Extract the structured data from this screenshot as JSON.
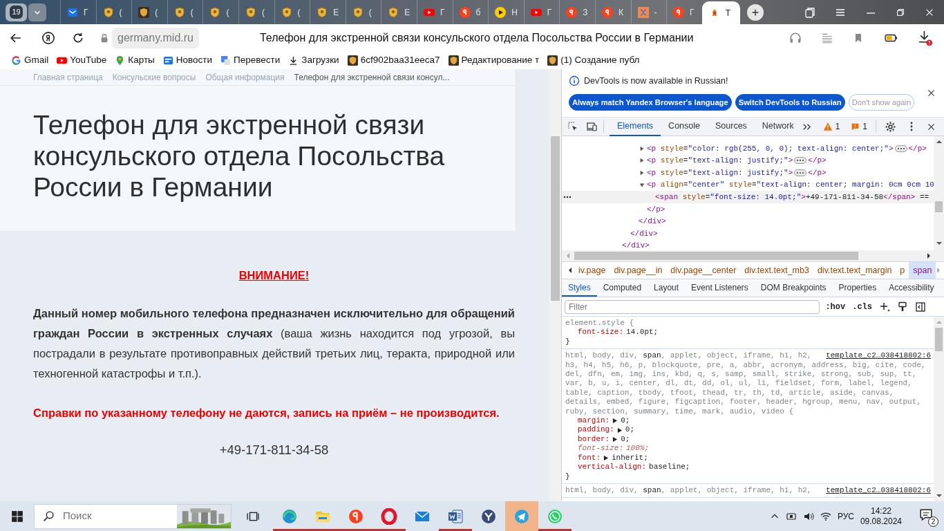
{
  "tab_strip": {
    "tab_count": "19",
    "tabs": [
      {
        "kind": "mail",
        "label": "Г",
        "selected": false
      },
      {
        "kind": "shield",
        "label": "(",
        "selected": false
      },
      {
        "kind": "shield-dark",
        "label": "(",
        "selected": false
      },
      {
        "kind": "shield",
        "label": "(",
        "selected": false
      },
      {
        "kind": "shield",
        "label": "(",
        "selected": false
      },
      {
        "kind": "shield",
        "label": "(",
        "selected": false
      },
      {
        "kind": "shield",
        "label": "(",
        "selected": false
      },
      {
        "kind": "shield",
        "label": "Е",
        "selected": false
      },
      {
        "kind": "shield",
        "label": "(",
        "selected": false
      },
      {
        "kind": "shield",
        "label": "Е",
        "selected": false
      },
      {
        "kind": "youtube",
        "label": "Г",
        "selected": false
      },
      {
        "kind": "yandex",
        "label": "б",
        "selected": false
      },
      {
        "kind": "play",
        "label": "Н",
        "selected": false
      },
      {
        "kind": "youtube",
        "label": "Г",
        "selected": false
      },
      {
        "kind": "yandex",
        "label": "З",
        "selected": false
      },
      {
        "kind": "yandex",
        "label": "К",
        "selected": false
      },
      {
        "kind": "pattern",
        "label": "-",
        "selected": false
      },
      {
        "kind": "yandex",
        "label": "Г",
        "selected": false
      },
      {
        "kind": "emblem",
        "label": "Т",
        "selected": true
      }
    ]
  },
  "toolbar": {
    "url": "germany.mid.ru",
    "page_title": "Телефон для экстренной связи консульского отдела Посольства России в Германии",
    "download_alert": true
  },
  "bookmarks": [
    {
      "kind": "google",
      "label": "Gmail"
    },
    {
      "kind": "youtube",
      "label": "YouTube"
    },
    {
      "kind": "maps",
      "label": "Карты"
    },
    {
      "kind": "news",
      "label": "Новости"
    },
    {
      "kind": "translate",
      "label": "Перевести"
    },
    {
      "kind": "download",
      "label": "Загрузки"
    },
    {
      "kind": "shield-dark",
      "label": "6cf902baa31eeca7"
    },
    {
      "kind": "shield-dark",
      "label": "Редактирование т"
    },
    {
      "kind": "shield-dark",
      "label": "(1) Создание публ"
    }
  ],
  "page": {
    "breadcrumbs": [
      "Главная страница",
      "Консульские вопросы",
      "Общая информация",
      "Телефон для экстренной связи консул..."
    ],
    "heading": "Телефон для экстренной связи консульского отдела Посольства России в Германии",
    "notice": "ВНИМАНИЕ!",
    "paragraph": "**Данный номер мобильного телефона предназначен исключительно для обращений граждан России в экстренных случаях** (ваша жизнь находится под угрозой, вы пострадали в результате противоправных действий третьих лиц, теракта, природной или техногенной катастрофы и т.п.).",
    "warning": "Справки по указанному телефону не даются, запись на приём – не производится.",
    "phone": "+49-171-811-34-58"
  },
  "devtools": {
    "infobar": {
      "message": "DevTools is now available in Russian!",
      "buttons": [
        {
          "label": "Always match Yandex Browser's language",
          "kind": "primary"
        },
        {
          "label": "Switch DevTools to Russian",
          "kind": "primary"
        },
        {
          "label": "Don't show again",
          "kind": "outline"
        }
      ]
    },
    "panels": [
      {
        "label": "Elements",
        "selected": true
      },
      {
        "label": "Console",
        "selected": false
      },
      {
        "label": "Sources",
        "selected": false
      },
      {
        "label": "Network",
        "selected": false
      }
    ],
    "warnings": "1",
    "issues": "1",
    "dom": {
      "close": "</div>",
      "children": [
        {
          "close": "</div>",
          "children": [
            {
              "close": "</div>",
              "children": [
                {
                  "open": "<p style=\"color: rgb(255, 0, 0); text-align: center;\">",
                  "close": "</p>",
                  "expanded": false
                },
                {
                  "open": "<p style=\"text-align: justify;\">",
                  "close": "</p>",
                  "expanded": false
                },
                {
                  "open": "<p style=\"text-align: justify;\">",
                  "close": "</p>",
                  "expanded": false
                },
                {
                  "open": "<p align=\"center\" style=\"text-align: center; margin: 0cm 0cm 10",
                  "close": "</p>",
                  "expanded": true,
                  "children": [
                    {
                      "open": "<span style=\"font-size: 14.0pt;\">+49-171-811-34-58</span> ==",
                      "selected": true
                    }
                  ]
                }
              ]
            }
          ]
        }
      ]
    },
    "crumbs": [
      {
        "label": "iv.page",
        "selected": false
      },
      {
        "label": "div.page__in",
        "selected": false
      },
      {
        "label": "div.page__center",
        "selected": false
      },
      {
        "label": "div.text.text_mb3",
        "selected": false
      },
      {
        "label": "div.text.text_margin",
        "selected": false
      },
      {
        "label": "p",
        "selected": false
      },
      {
        "label": "span",
        "selected": true
      }
    ],
    "style_tabs": [
      {
        "label": "Styles",
        "selected": true
      },
      {
        "label": "Computed",
        "selected": false
      },
      {
        "label": "Layout",
        "selected": false
      },
      {
        "label": "Event Listeners",
        "selected": false
      },
      {
        "label": "DOM Breakpoints",
        "selected": false
      },
      {
        "label": "Properties",
        "selected": false
      },
      {
        "label": "Accessibility",
        "selected": false
      }
    ],
    "filter_placeholder": "Filter",
    "hov": ":hov",
    "cls": ".cls",
    "rules": [
      {
        "selector": [
          "element.style {"
        ],
        "close": "}",
        "properties": [
          {
            "name": "font-size:",
            "value": "14.0pt;",
            "expandable": false,
            "overridden": false
          }
        ]
      },
      {
        "selector": [
          "html, body, div, **span**, applet, object, iframe, h1, h2,",
          "h3, h4, h5, h6, p, blockquote, pre, a, abbr, acronym, address, big, cite, code,",
          "del, dfn, em, img, ins, kbd, q, s, samp, small, strike, strong, sub, sup, tt,",
          "var, b, u, i, center, dl, dt, dd, ol, ul, li, fieldset, form, label, legend,",
          "table, caption, tbody, tfoot, thead, tr, th, td, article, aside, canvas,",
          "details, embed, figure, figcaption, footer, header, hgroup, menu, nav, output,",
          "ruby, section, summary, time, mark, audio, video {"
        ],
        "source": "template_c2…038418802:6",
        "close": "}",
        "properties": [
          {
            "name": "margin:",
            "value": "0;",
            "expandable": true,
            "overridden": false
          },
          {
            "name": "padding:",
            "value": "0;",
            "expandable": true,
            "overridden": false
          },
          {
            "name": "border:",
            "value": "0;",
            "expandable": true,
            "overridden": false
          },
          {
            "name": "font-size:",
            "value": "100%;",
            "expandable": false,
            "overridden": true
          },
          {
            "name": "font:",
            "value": "inherit;",
            "expandable": true,
            "overridden": false
          },
          {
            "name": "vertical-align:",
            "value": "baseline;",
            "expandable": false,
            "overridden": false
          }
        ]
      },
      {
        "selector": [
          "html, body, div, **span**, applet, object, iframe, h1, h2,"
        ],
        "source": "template_c2…038418802:6"
      }
    ]
  },
  "taskbar": {
    "search_placeholder": "Поиск",
    "apps": [
      {
        "kind": "edge",
        "running": true,
        "selected": false
      },
      {
        "kind": "explorer",
        "running": true,
        "selected": false
      },
      {
        "kind": "yandex",
        "running": true,
        "selected": false
      },
      {
        "kind": "opera",
        "running": true,
        "selected": false
      },
      {
        "kind": "mail",
        "running": false,
        "selected": false
      },
      {
        "kind": "word",
        "running": true,
        "selected": false
      },
      {
        "kind": "ybrowser",
        "running": false,
        "selected": false
      },
      {
        "kind": "telegram",
        "running": false,
        "selected": true
      },
      {
        "kind": "whatsapp",
        "running": true,
        "selected": false
      }
    ],
    "language": "РУС",
    "time": "14:22",
    "date": "09.08.2024",
    "notifications": "2"
  }
}
